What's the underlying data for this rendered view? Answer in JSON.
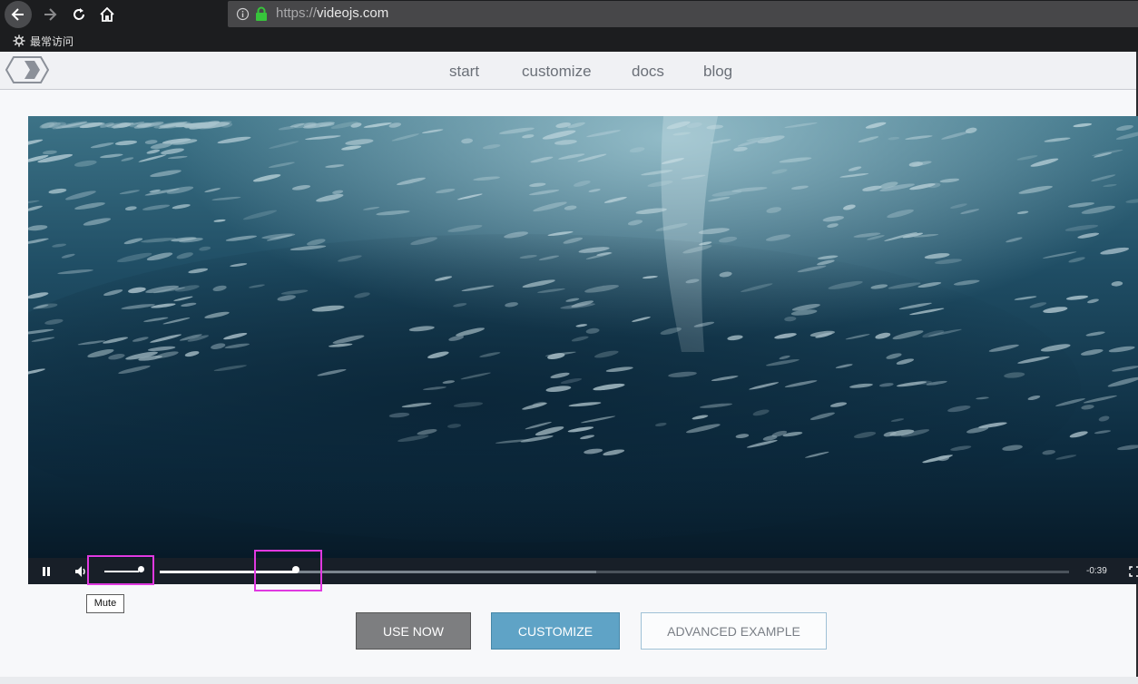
{
  "browser": {
    "url_scheme": "https://",
    "url_host": "videojs.com",
    "bookmarks_label": "最常访问",
    "icons": [
      "back-arrow-icon",
      "forward-arrow-icon",
      "reload-icon",
      "home-icon",
      "info-icon",
      "lock-icon",
      "gear-icon"
    ]
  },
  "site": {
    "nav": [
      "start",
      "customize",
      "docs",
      "blog"
    ]
  },
  "player": {
    "time_remaining": "-0:39",
    "volume_level": 0.9,
    "progress_fraction": 0.15,
    "buffered_fraction": 0.48,
    "tooltip": "Mute",
    "icons": [
      "pause-icon",
      "volume-icon",
      "fullscreen-icon"
    ]
  },
  "actions": {
    "use_now": "USE NOW",
    "customize": "CUSTOMIZE",
    "advanced": "ADVANCED EXAMPLE"
  },
  "colors": {
    "highlight": "#e039e0",
    "customize_button": "#5fa3c6",
    "use_now_button": "#7d7e80"
  }
}
